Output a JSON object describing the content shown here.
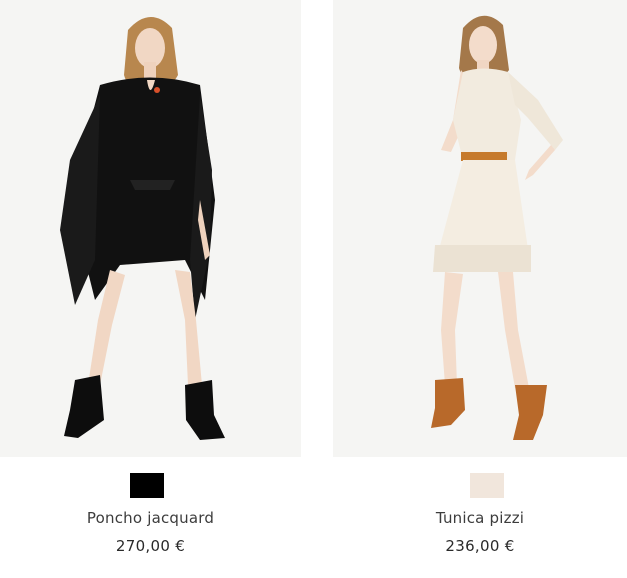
{
  "products": [
    {
      "name": "Poncho jacquard",
      "price": "270,00 €",
      "swatch_color": "#000000",
      "image_alt": "model wearing black fringed jacquard poncho with black fringe boots"
    },
    {
      "name": "Tunica pizzi",
      "price": "236,00 €",
      "swatch_color": "#f1e6dc",
      "image_alt": "model wearing cream lace tunic dress with tan belt and brown fringe boots"
    }
  ]
}
